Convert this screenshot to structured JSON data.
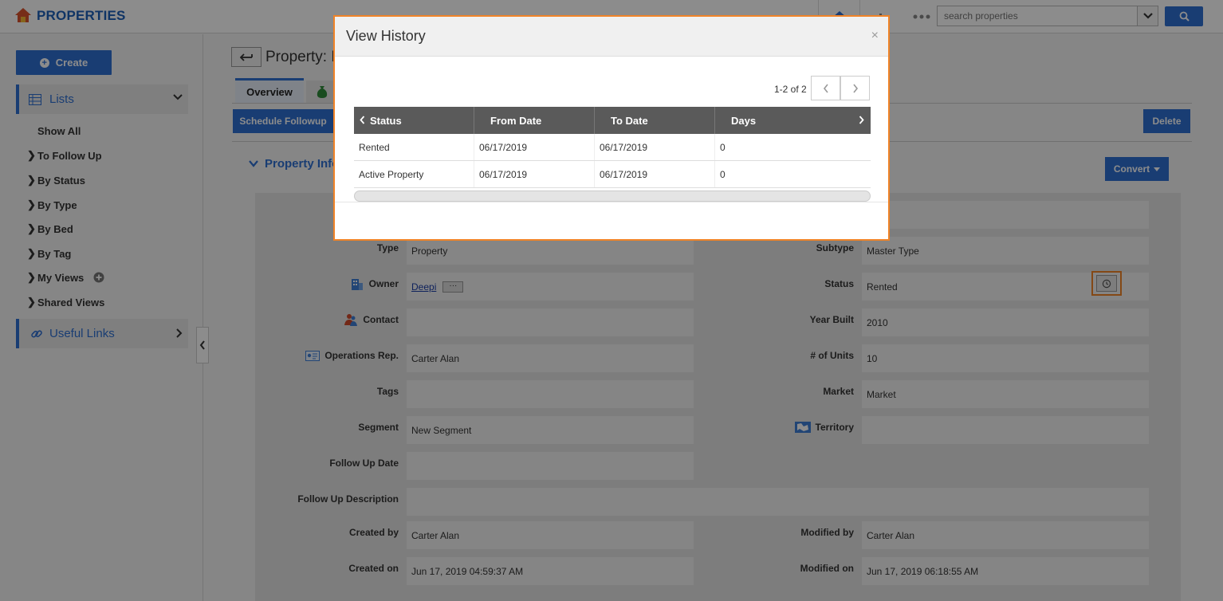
{
  "app": {
    "title": "PROPERTIES"
  },
  "search": {
    "placeholder": "search properties"
  },
  "sidebar": {
    "create_label": "Create",
    "lists_label": "Lists",
    "items": [
      {
        "label": "Show All"
      },
      {
        "label": "To Follow Up"
      },
      {
        "label": "By Status"
      },
      {
        "label": "By Type"
      },
      {
        "label": "By Bed"
      },
      {
        "label": "By Tag"
      },
      {
        "label": "My Views"
      },
      {
        "label": "Shared Views"
      }
    ],
    "useful_links_label": "Useful Links"
  },
  "main": {
    "page_title": "Property: F",
    "tabs": [
      {
        "label": "Overview"
      }
    ],
    "schedule_followup_label": "Schedule Followup",
    "delete_label": "Delete",
    "section_title": "Property Info",
    "convert_label": "Convert",
    "fields": {
      "type": {
        "label": "Type",
        "value": "Property"
      },
      "subtype": {
        "label": "Subtype",
        "value": "Master Type"
      },
      "owner": {
        "label": "Owner",
        "value": "Deepi",
        "more": "···"
      },
      "status": {
        "label": "Status",
        "value": "Rented"
      },
      "contact": {
        "label": "Contact",
        "value": ""
      },
      "year_built": {
        "label": "Year Built",
        "value": "2010"
      },
      "operations_rep": {
        "label": "Operations Rep.",
        "value": "Carter Alan"
      },
      "units": {
        "label": "# of Units",
        "value": "10"
      },
      "tags": {
        "label": "Tags",
        "value": ""
      },
      "market": {
        "label": "Market",
        "value": "Market"
      },
      "segment": {
        "label": "Segment",
        "value": "New Segment"
      },
      "territory": {
        "label": "Territory",
        "value": ""
      },
      "follow_up_date": {
        "label": "Follow Up Date",
        "value": ""
      },
      "follow_up_description": {
        "label": "Follow Up Description",
        "value": ""
      },
      "created_by": {
        "label": "Created by",
        "value": "Carter Alan"
      },
      "modified_by": {
        "label": "Modified by",
        "value": "Carter Alan"
      },
      "created_on": {
        "label": "Created on",
        "value": "Jun 17, 2019 04:59:37 AM"
      },
      "modified_on": {
        "label": "Modified on",
        "value": "Jun 17, 2019 06:18:55 AM"
      }
    }
  },
  "modal": {
    "title": "View History",
    "close": "×",
    "pager": "1-2 of 2",
    "columns": [
      "Status",
      "From Date",
      "To Date",
      "Days"
    ],
    "rows": [
      [
        "Rented",
        "06/17/2019",
        "06/17/2019",
        "0"
      ],
      [
        "Active Property",
        "06/17/2019",
        "06/17/2019",
        "0"
      ]
    ]
  },
  "colors": {
    "accent": "#2f6fd1",
    "highlight": "#f08327",
    "grid_header": "#5a5a5a"
  }
}
